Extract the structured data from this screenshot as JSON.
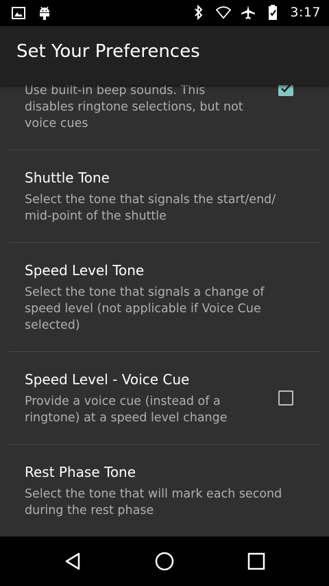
{
  "status_bar": {
    "time": "3:17",
    "icons": [
      "image-icon",
      "android-icon",
      "bluetooth-icon",
      "wifi-icon",
      "airplane-icon",
      "battery-icon"
    ]
  },
  "app_bar": {
    "title": "Set Your Preferences"
  },
  "preferences": [
    {
      "title": "",
      "summary": "Use built-in beep sounds. This disables ringtone selections, but not voice cues",
      "checkbox": true,
      "checked": true
    },
    {
      "title": "Shuttle Tone",
      "summary": "Select the tone that signals the start/end/ mid-point of the shuttle",
      "checkbox": false
    },
    {
      "title": "Speed Level Tone",
      "summary": "Select the tone that signals a change of speed level (not applicable if Voice Cue selected)",
      "checkbox": false
    },
    {
      "title": "Speed Level - Voice Cue",
      "summary": "Provide a voice cue (instead of a ringtone) at a speed level change",
      "checkbox": true,
      "checked": false
    },
    {
      "title": "Rest Phase Tone",
      "summary": "Select the tone that will mark each second during the rest phase",
      "checkbox": false
    }
  ],
  "nav_bar": {
    "buttons": [
      "back-icon",
      "home-icon",
      "recents-icon"
    ]
  },
  "colors": {
    "background": "#303030",
    "app_bar": "#212121",
    "accent": "#80cbc4",
    "summary_text": "#b0b0b0"
  }
}
